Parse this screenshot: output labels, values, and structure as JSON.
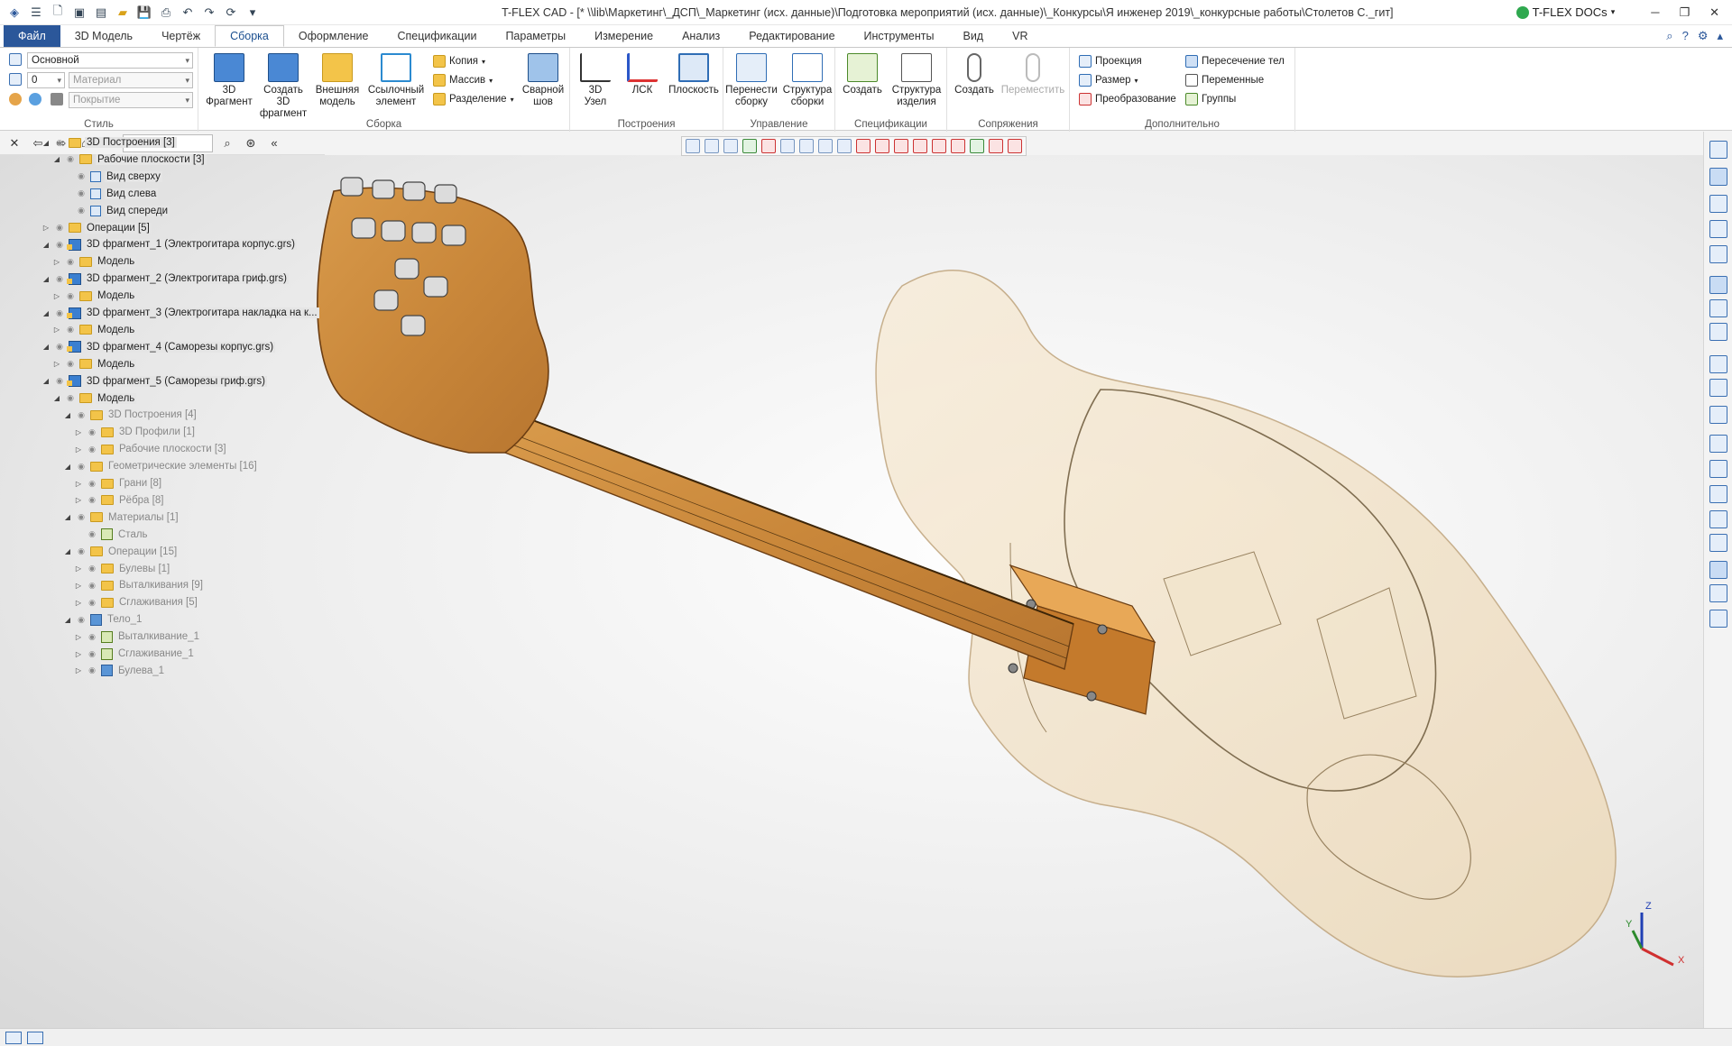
{
  "titlebar": {
    "title": "T-FLEX CAD - [* \\\\lib\\Маркетинг\\_ДСП\\_Маркетинг (исх. данные)\\Подготовка мероприятий (исх. данные)\\_Конкурсы\\Я инженер 2019\\_конкурсные работы\\Столетов С._гит]",
    "tdocs_label": "T-FLEX DOCs",
    "minimize": "─",
    "restore": "❐",
    "close": "✕"
  },
  "tabs": [
    "Файл",
    "3D Модель",
    "Чертёж",
    "Сборка",
    "Оформление",
    "Спецификации",
    "Параметры",
    "Измерение",
    "Анализ",
    "Редактирование",
    "Инструменты",
    "Вид",
    "VR"
  ],
  "active_tab": "Сборка",
  "ribbon": {
    "style": {
      "label": "Стиль",
      "layer_value": "Основной",
      "level_value": "0",
      "material_placeholder": "Материал",
      "coating_placeholder": "Покрытие"
    },
    "assembly": {
      "label": "Сборка",
      "btn_3d_fragment": "3D\nФрагмент",
      "btn_create_3d_fragment": "Создать 3D\nфрагмент",
      "btn_external_model": "Внешняя\nмодель",
      "btn_link_element": "Ссылочный\nэлемент",
      "small_copy": "Копия",
      "small_array": "Массив",
      "small_split": "Разделение",
      "btn_weld": "Сварной\nшов"
    },
    "constructions": {
      "label": "Построения",
      "btn_3d_node": "3D\nУзел",
      "btn_lcs": "ЛСК",
      "btn_plane": "Плоскость"
    },
    "control": {
      "label": "Управление",
      "btn_rebuild": "Перенести\nсборку",
      "btn_structure": "Структура\nсборки"
    },
    "specs": {
      "label": "Спецификации",
      "btn_create": "Создать",
      "btn_product_structure": "Структура\nизделия"
    },
    "mates": {
      "label": "Сопряжения",
      "btn_create": "Создать",
      "btn_move": "Переместить"
    },
    "extra": {
      "label": "Дополнительно",
      "projection": "Проекция",
      "size": "Размер",
      "transform": "Преобразование",
      "intersection": "Пересечение тел",
      "variables": "Переменные",
      "groups": "Группы"
    }
  },
  "tree": [
    {
      "label": "3D Построения [3]",
      "indent": 0,
      "icon": "folder",
      "arrow": "◢",
      "sel": true
    },
    {
      "label": "Рабочие плоскости [3]",
      "indent": 1,
      "icon": "folder",
      "arrow": "◢",
      "sel": true
    },
    {
      "label": "Вид сверху",
      "indent": 2,
      "icon": "plane",
      "arrow": "",
      "sel": true
    },
    {
      "label": "Вид слева",
      "indent": 2,
      "icon": "plane",
      "arrow": "",
      "sel": true
    },
    {
      "label": "Вид спереди",
      "indent": 2,
      "icon": "plane",
      "arrow": "",
      "sel": true
    },
    {
      "label": "Операции [5]",
      "indent": 0,
      "icon": "folder",
      "arrow": "▷",
      "sel": true
    },
    {
      "label": "3D фрагмент_1 (Электрогитара корпус.grs)",
      "indent": 0,
      "icon": "frag",
      "arrow": "◢",
      "sel": true
    },
    {
      "label": "Модель",
      "indent": 1,
      "icon": "folder",
      "arrow": "▷",
      "sel": true
    },
    {
      "label": "3D фрагмент_2 (Электрогитара гриф.grs)",
      "indent": 0,
      "icon": "frag",
      "arrow": "◢",
      "sel": true
    },
    {
      "label": "Модель",
      "indent": 1,
      "icon": "folder",
      "arrow": "▷",
      "sel": true
    },
    {
      "label": "3D фрагмент_3 (Электрогитара накладка на к...",
      "indent": 0,
      "icon": "frag",
      "arrow": "◢",
      "sel": true
    },
    {
      "label": "Модель",
      "indent": 1,
      "icon": "folder",
      "arrow": "▷",
      "sel": true
    },
    {
      "label": "3D фрагмент_4 (Саморезы корпус.grs)",
      "indent": 0,
      "icon": "frag",
      "arrow": "◢",
      "sel": true
    },
    {
      "label": "Модель",
      "indent": 1,
      "icon": "folder",
      "arrow": "▷",
      "sel": true
    },
    {
      "label": "3D фрагмент_5 (Саморезы гриф.grs)",
      "indent": 0,
      "icon": "frag",
      "arrow": "◢",
      "sel": true
    },
    {
      "label": "Модель",
      "indent": 1,
      "icon": "folder",
      "arrow": "◢",
      "sel": true
    },
    {
      "label": "3D Построения [4]",
      "indent": 2,
      "icon": "folder",
      "arrow": "◢",
      "dim": true
    },
    {
      "label": "3D Профили [1]",
      "indent": 3,
      "icon": "folder",
      "arrow": "▷",
      "dim": true
    },
    {
      "label": "Рабочие плоскости [3]",
      "indent": 3,
      "icon": "folder",
      "arrow": "▷",
      "dim": true
    },
    {
      "label": "Геометрические элементы [16]",
      "indent": 2,
      "icon": "folder",
      "arrow": "◢",
      "dim": true
    },
    {
      "label": "Грани [8]",
      "indent": 3,
      "icon": "folder",
      "arrow": "▷",
      "dim": true
    },
    {
      "label": "Рёбра [8]",
      "indent": 3,
      "icon": "folder",
      "arrow": "▷",
      "dim": true
    },
    {
      "label": "Материалы [1]",
      "indent": 2,
      "icon": "folder",
      "arrow": "◢",
      "dim": true
    },
    {
      "label": "Сталь",
      "indent": 3,
      "icon": "op",
      "arrow": "",
      "dim": true
    },
    {
      "label": "Операции [15]",
      "indent": 2,
      "icon": "folder",
      "arrow": "◢",
      "dim": true
    },
    {
      "label": "Булевы [1]",
      "indent": 3,
      "icon": "folder",
      "arrow": "▷",
      "dim": true
    },
    {
      "label": "Выталкивания [9]",
      "indent": 3,
      "icon": "folder",
      "arrow": "▷",
      "dim": true
    },
    {
      "label": "Сглаживания [5]",
      "indent": 3,
      "icon": "folder",
      "arrow": "▷",
      "dim": true
    },
    {
      "label": "Тело_1",
      "indent": 2,
      "icon": "solid",
      "arrow": "◢",
      "dim": true
    },
    {
      "label": "Выталкивание_1",
      "indent": 3,
      "icon": "op",
      "arrow": "▷",
      "dim": true
    },
    {
      "label": "Сглаживание_1",
      "indent": 3,
      "icon": "op",
      "arrow": "▷",
      "dim": true
    },
    {
      "label": "Булева_1",
      "indent": 3,
      "icon": "solid",
      "arrow": "▷",
      "dim": true
    }
  ],
  "axes": {
    "z": "Z",
    "y": "Y",
    "x": "X"
  }
}
